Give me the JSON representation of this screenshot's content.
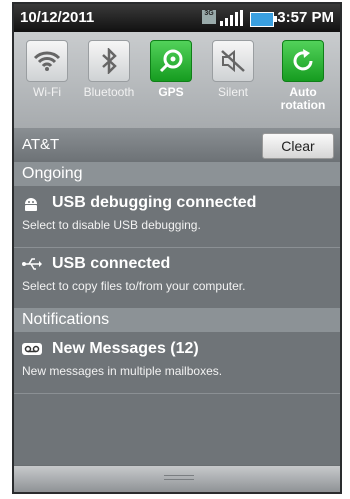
{
  "status_bar": {
    "date": "10/12/2011",
    "time": "3:57 PM",
    "network_badge": "3G",
    "icons": [
      "3g-icon",
      "signal-icon",
      "battery-icon"
    ]
  },
  "toggles": [
    {
      "label": "Wi-Fi",
      "icon": "wifi-icon",
      "active": false
    },
    {
      "label": "Bluetooth",
      "icon": "bluetooth-icon",
      "active": false
    },
    {
      "label": "GPS",
      "icon": "gps-icon",
      "active": true
    },
    {
      "label": "Silent",
      "icon": "silent-icon",
      "active": false
    },
    {
      "label": "Auto rotation",
      "icon": "rotation-icon",
      "active": true
    }
  ],
  "carrier": {
    "name": "AT&T",
    "clear_label": "Clear"
  },
  "sections": {
    "ongoing": "Ongoing",
    "notifications": "Notifications"
  },
  "ongoing_items": [
    {
      "title": "USB debugging connected",
      "subtitle": "Select to disable USB debugging.",
      "icon": "android-icon"
    },
    {
      "title": "USB connected",
      "subtitle": "Select to copy files to/from your computer.",
      "icon": "usb-icon"
    }
  ],
  "notification_items": [
    {
      "title": "New Messages (12)",
      "subtitle": "New messages in multiple mailboxes.",
      "icon": "voicemail-icon"
    }
  ],
  "colors": {
    "active_toggle": "#2dbb36",
    "panel": "#6f7478"
  }
}
